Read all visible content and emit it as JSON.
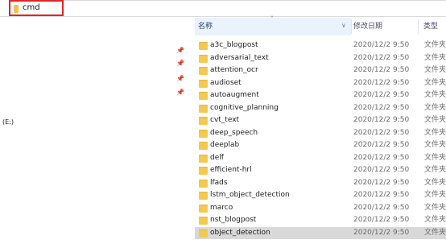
{
  "address": {
    "value": "cmd"
  },
  "nav": {
    "drive_label": "(E:)"
  },
  "columns": {
    "name": "名称",
    "date": "修改日期",
    "type": "类型"
  },
  "files": [
    {
      "name": "a3c_blogpost",
      "date": "2020/12/2 9:50",
      "type": "文件夹"
    },
    {
      "name": "adversarial_text",
      "date": "2020/12/2 9:50",
      "type": "文件夹"
    },
    {
      "name": "attention_ocr",
      "date": "2020/12/2 9:50",
      "type": "文件夹"
    },
    {
      "name": "audioset",
      "date": "2020/12/2 9:50",
      "type": "文件夹"
    },
    {
      "name": "autoaugment",
      "date": "2020/12/2 9:50",
      "type": "文件夹"
    },
    {
      "name": "cognitive_planning",
      "date": "2020/12/2 9:50",
      "type": "文件夹"
    },
    {
      "name": "cvt_text",
      "date": "2020/12/2 9:50",
      "type": "文件夹"
    },
    {
      "name": "deep_speech",
      "date": "2020/12/2 9:50",
      "type": "文件夹"
    },
    {
      "name": "deeplab",
      "date": "2020/12/2 9:50",
      "type": "文件夹"
    },
    {
      "name": "delf",
      "date": "2020/12/2 9:50",
      "type": "文件夹"
    },
    {
      "name": "efficient-hrl",
      "date": "2020/12/2 9:50",
      "type": "文件夹"
    },
    {
      "name": "lfads",
      "date": "2020/12/2 9:50",
      "type": "文件夹"
    },
    {
      "name": "lstm_object_detection",
      "date": "2020/12/2 9:50",
      "type": "文件夹"
    },
    {
      "name": "marco",
      "date": "2020/12/2 9:50",
      "type": "文件夹"
    },
    {
      "name": "nst_blogpost",
      "date": "2020/12/2 9:50",
      "type": "文件夹"
    },
    {
      "name": "object_detection",
      "date": "2020/12/2 9:50",
      "type": "文件夹"
    }
  ]
}
